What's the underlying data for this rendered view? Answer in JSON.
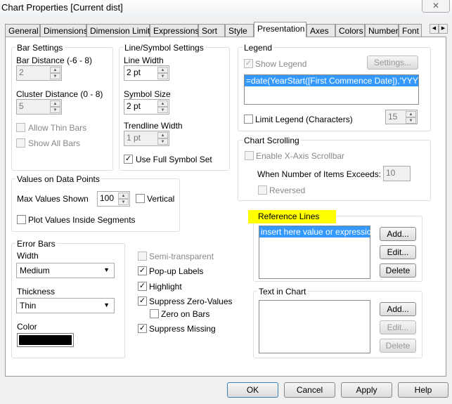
{
  "window": {
    "title": "Chart Properties [Current dist]",
    "close_icon": "close-icon"
  },
  "tabs": [
    "General",
    "Dimensions",
    "Dimension Limits",
    "Expressions",
    "Sort",
    "Style",
    "Presentation",
    "Axes",
    "Colors",
    "Number",
    "Font"
  ],
  "active_tab": "Presentation",
  "bar_settings": {
    "title": "Bar Settings",
    "bar_distance_label": "Bar Distance (-6 - 8)",
    "bar_distance": "2",
    "cluster_distance_label": "Cluster Distance (0 - 8)",
    "cluster_distance": "5",
    "allow_thin_bars": "Allow Thin Bars",
    "show_all_bars": "Show All Bars"
  },
  "line_symbol": {
    "title": "Line/Symbol Settings",
    "line_width_label": "Line Width",
    "line_width": "2 pt",
    "symbol_size_label": "Symbol Size",
    "symbol_size": "2 pt",
    "trendline_width_label": "Trendline Width",
    "trendline_width": "1 pt",
    "use_full_symbol_set": "Use Full Symbol Set"
  },
  "values_on_points": {
    "title": "Values on Data Points",
    "max_values_label": "Max Values Shown",
    "max_values": "100",
    "vertical": "Vertical",
    "plot_inside": "Plot Values Inside Segments"
  },
  "error_bars": {
    "title": "Error Bars",
    "width_label": "Width",
    "width": "Medium",
    "thickness_label": "Thickness",
    "thickness": "Thin",
    "color_label": "Color",
    "color": "#000000"
  },
  "options": {
    "semi_transparent": "Semi-transparent",
    "popup_labels": "Pop-up Labels",
    "highlight": "Highlight",
    "suppress_zero": "Suppress Zero-Values",
    "zero_on_bars": "Zero on Bars",
    "suppress_missing": "Suppress Missing"
  },
  "legend": {
    "title": "Legend",
    "show_legend": "Show Legend",
    "settings": "Settings...",
    "item": "=date(YearStart([First Commence Date]),'YYYY')",
    "limit_legend": "Limit Legend (Characters)",
    "limit_value": "15"
  },
  "chart_scrolling": {
    "title": "Chart Scrolling",
    "enable_scrollbar": "Enable X-Axis Scrollbar",
    "items_exceeds_label": "When Number of Items Exceeds:",
    "items_exceeds": "10",
    "reversed": "Reversed"
  },
  "reference_lines": {
    "title": "Reference Lines",
    "highlight_color": "#ffff00",
    "item": "insert here value or expression",
    "add": "Add...",
    "edit": "Edit...",
    "delete": "Delete"
  },
  "text_in_chart": {
    "title": "Text in Chart",
    "add": "Add...",
    "edit": "Edit...",
    "delete": "Delete"
  },
  "footer": {
    "ok": "OK",
    "cancel": "Cancel",
    "apply": "Apply",
    "help": "Help"
  }
}
